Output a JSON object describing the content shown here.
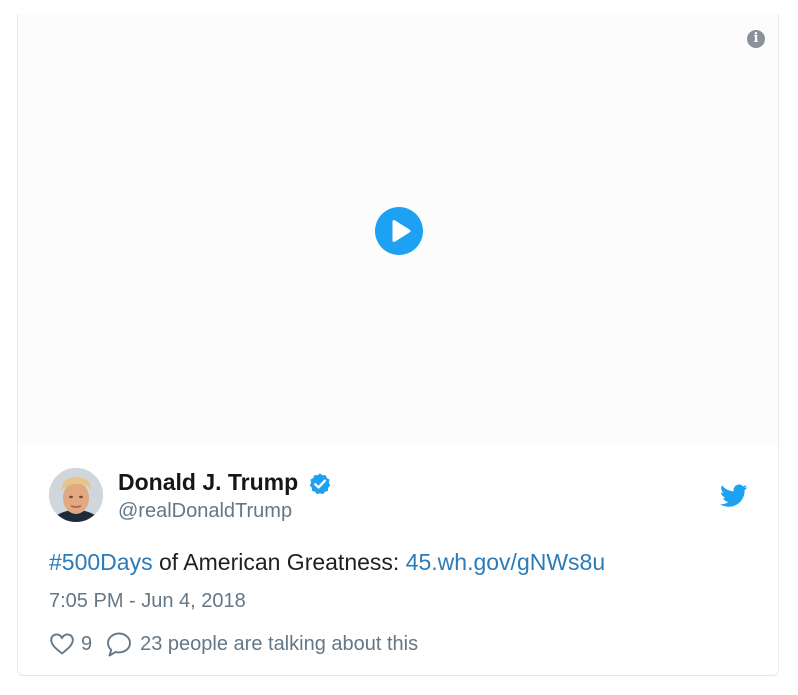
{
  "media": {
    "info_icon": "info-icon",
    "play_icon": "play-icon",
    "accent_color": "#1da1f2"
  },
  "tweet": {
    "avatar_icon": "avatar-photo",
    "display_name": "Donald J. Trump",
    "verified_icon": "verified-badge-icon",
    "screen_name": "@realDonaldTrump",
    "brand_icon": "twitter-bird-icon",
    "text": {
      "hashtag": "#500Days",
      "body": " of American Greatness: ",
      "link": "45.wh.gov/gNWs8u"
    },
    "timestamp": "7:05 PM - Jun 4, 2018",
    "likes": "9",
    "talking": "23 people are talking about this",
    "link_color": "#2b7bb9",
    "brand_color": "#1da1f2"
  }
}
